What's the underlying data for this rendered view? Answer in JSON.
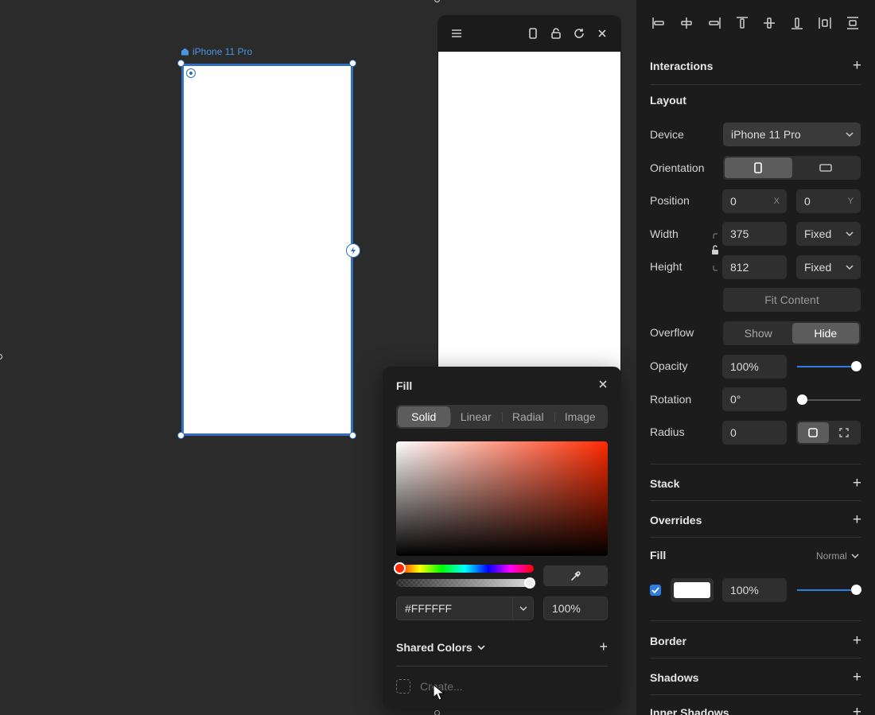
{
  "canvas": {
    "frame_label": "iPhone 11 Pro",
    "frame_fill": "#FFFFFF",
    "selection_color": "#2E6FC2"
  },
  "fill_popover": {
    "title": "Fill",
    "tabs": [
      "Solid",
      "Linear",
      "Radial",
      "Image"
    ],
    "active_tab": "Solid",
    "hex_value": "#FFFFFF",
    "alpha_value": "100%",
    "shared_colors_label": "Shared Colors",
    "create_placeholder": "Create..."
  },
  "panel": {
    "interactions": "Interactions",
    "layout": "Layout",
    "device_label": "Device",
    "device_value": "iPhone 11 Pro",
    "orientation_label": "Orientation",
    "position_label": "Position",
    "position_x": "0",
    "position_x_suffix": "X",
    "position_y": "0",
    "position_y_suffix": "Y",
    "width_label": "Width",
    "width_value": "375",
    "width_mode": "Fixed",
    "height_label": "Height",
    "height_value": "812",
    "height_mode": "Fixed",
    "fit_content": "Fit Content",
    "overflow_label": "Overflow",
    "overflow_show": "Show",
    "overflow_hide": "Hide",
    "opacity_label": "Opacity",
    "opacity_value": "100%",
    "opacity_fraction": 1.0,
    "rotation_label": "Rotation",
    "rotation_value": "0°",
    "rotation_fraction": 0.0,
    "radius_label": "Radius",
    "radius_value": "0",
    "stack": "Stack",
    "overrides": "Overrides",
    "fill": "Fill",
    "fill_blend": "Normal",
    "fill_opacity": "100%",
    "fill_opacity_fraction": 1.0,
    "border": "Border",
    "shadows": "Shadows",
    "inner_shadows": "Inner Shadows",
    "accent": "#2E7DE3"
  }
}
